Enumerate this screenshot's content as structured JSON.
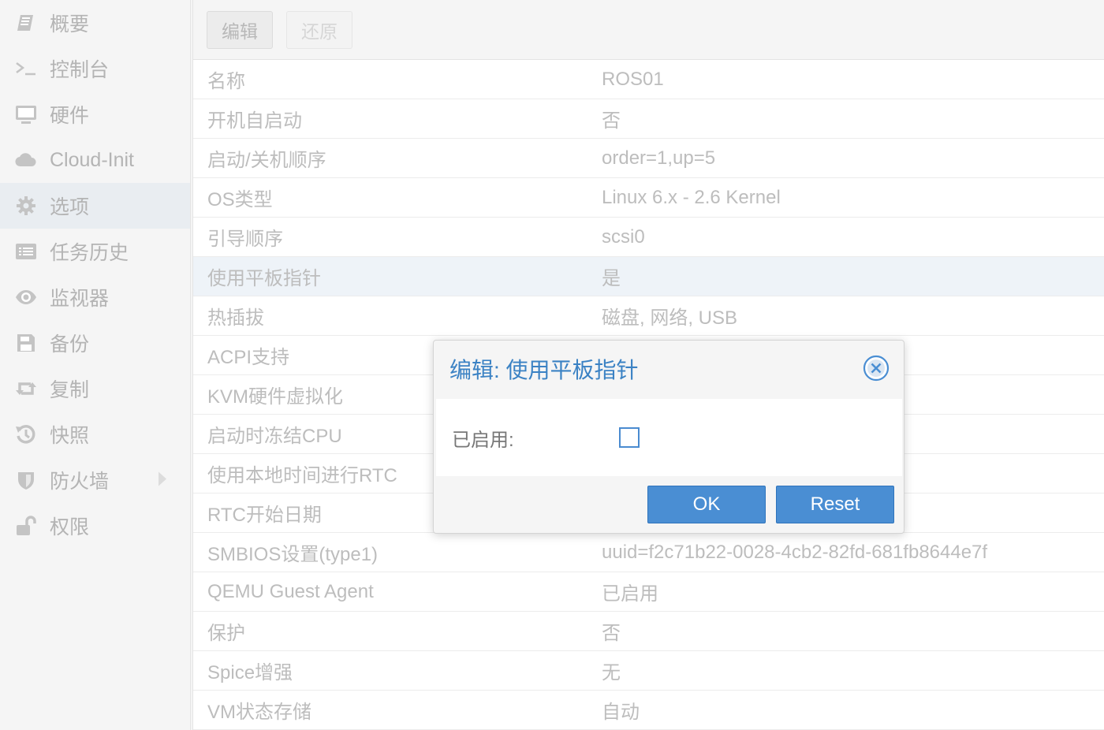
{
  "sidebar": {
    "items": [
      {
        "label": "概要",
        "icon": "book-icon"
      },
      {
        "label": "控制台",
        "icon": "terminal-icon"
      },
      {
        "label": "硬件",
        "icon": "monitor-icon"
      },
      {
        "label": "Cloud-Init",
        "icon": "cloud-icon"
      },
      {
        "label": "选项",
        "icon": "gear-icon",
        "active": true
      },
      {
        "label": "任务历史",
        "icon": "list-icon"
      },
      {
        "label": "监视器",
        "icon": "eye-icon"
      },
      {
        "label": "备份",
        "icon": "floppy-icon"
      },
      {
        "label": "复制",
        "icon": "retweet-icon"
      },
      {
        "label": "快照",
        "icon": "history-icon"
      },
      {
        "label": "防火墙",
        "icon": "shield-icon"
      },
      {
        "label": "权限",
        "icon": "unlock-icon"
      }
    ]
  },
  "toolbar": {
    "edit_label": "编辑",
    "revert_label": "还原"
  },
  "options": {
    "rows": [
      {
        "key": "名称",
        "value": "ROS01"
      },
      {
        "key": "开机自启动",
        "value": "否"
      },
      {
        "key": "启动/关机顺序",
        "value": "order=1,up=5"
      },
      {
        "key": "OS类型",
        "value": "Linux 6.x - 2.6 Kernel"
      },
      {
        "key": "引导顺序",
        "value": "scsi0"
      },
      {
        "key": "使用平板指针",
        "value": "是"
      },
      {
        "key": "热插拔",
        "value": "磁盘, 网络, USB"
      },
      {
        "key": "ACPI支持",
        "value": ""
      },
      {
        "key": "KVM硬件虚拟化",
        "value": ""
      },
      {
        "key": "启动时冻结CPU",
        "value": ""
      },
      {
        "key": "使用本地时间进行RTC",
        "value": ""
      },
      {
        "key": "RTC开始日期",
        "value": ""
      },
      {
        "key": "SMBIOS设置(type1)",
        "value": "uuid=f2c71b22-0028-4cb2-82fd-681fb8644e7f"
      },
      {
        "key": "QEMU Guest Agent",
        "value": "已启用"
      },
      {
        "key": "保护",
        "value": "否"
      },
      {
        "key": "Spice增强",
        "value": "无"
      },
      {
        "key": "VM状态存储",
        "value": "自动"
      }
    ],
    "selected_index": 5
  },
  "dialog": {
    "title": "编辑: 使用平板指针",
    "field_label": "已启用:",
    "checked": false,
    "ok_label": "OK",
    "reset_label": "Reset"
  },
  "colors": {
    "accent": "#4a8ed3",
    "title": "#3b82c4",
    "selected_row": "#eef3f8"
  }
}
